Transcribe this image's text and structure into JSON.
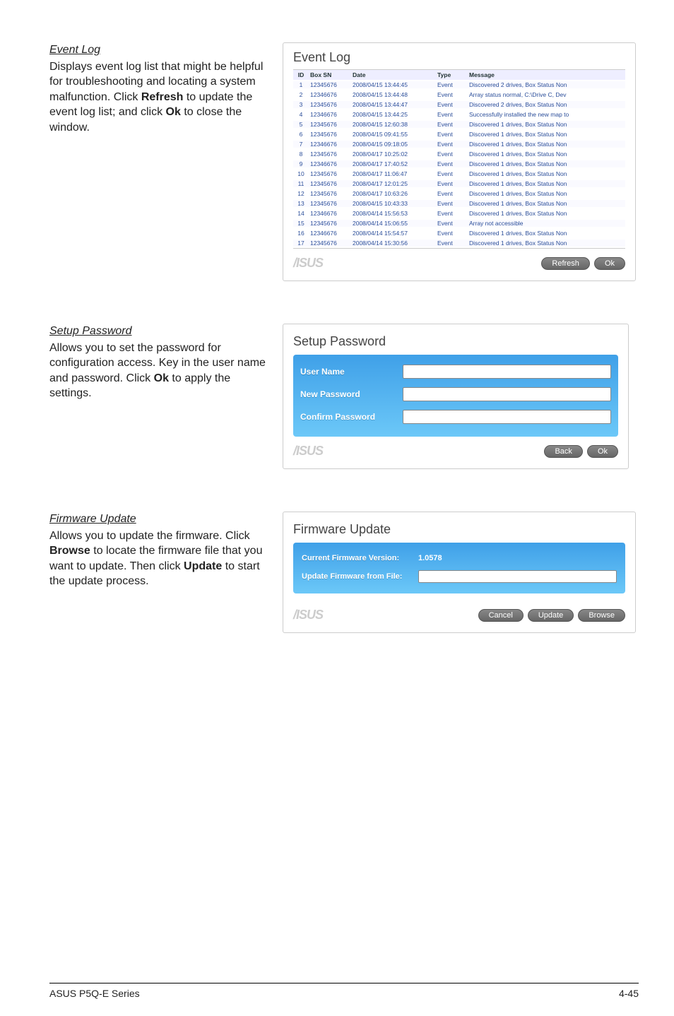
{
  "event_log": {
    "heading": "Event Log",
    "body_1": "Displays event log list that might be helpful for troubleshooting and locating a system malfunction. Click ",
    "body_bold_1": "Refresh",
    "body_2": " to update the event log list; and click ",
    "body_bold_2": "Ok",
    "body_3": " to close the window.",
    "panel_title": "Event Log",
    "cols": {
      "id": "ID",
      "sn": "Box SN",
      "date": "Date",
      "type": "Type",
      "msg": "Message"
    },
    "rows": [
      {
        "id": "1",
        "sn": "12345676",
        "date": "2008/04/15 13:44:45",
        "type": "Event",
        "msg": "Discovered 2 drives, Box Status Non"
      },
      {
        "id": "2",
        "sn": "12346676",
        "date": "2008/04/15 13:44:48",
        "type": "Event",
        "msg": "Array status normal, C:\\Drive C, Dev"
      },
      {
        "id": "3",
        "sn": "12345676",
        "date": "2008/04/15 13:44:47",
        "type": "Event",
        "msg": "Discovered 2 drives, Box Status Non"
      },
      {
        "id": "4",
        "sn": "12346676",
        "date": "2008/04/15 13:44:25",
        "type": "Event",
        "msg": "Successfully installed the new map to"
      },
      {
        "id": "5",
        "sn": "12345676",
        "date": "2008/04/15 12:60:38",
        "type": "Event",
        "msg": "Discovered 1 drives, Box Status Non"
      },
      {
        "id": "6",
        "sn": "12345676",
        "date": "2008/04/15 09:41:55",
        "type": "Event",
        "msg": "Discovered 1 drives, Box Status Non"
      },
      {
        "id": "7",
        "sn": "12346676",
        "date": "2008/04/15 09:18:05",
        "type": "Event",
        "msg": "Discovered 1 drives, Box Status Non"
      },
      {
        "id": "8",
        "sn": "12345676",
        "date": "2008/04/17 10:25:02",
        "type": "Event",
        "msg": "Discovered 1 drives, Box Status Non"
      },
      {
        "id": "9",
        "sn": "12346676",
        "date": "2008/04/17 17:40:52",
        "type": "Event",
        "msg": "Discovered 1 drives, Box Status Non"
      },
      {
        "id": "10",
        "sn": "12345676",
        "date": "2008/04/17 11:06:47",
        "type": "Event",
        "msg": "Discovered 1 drives, Box Status Non"
      },
      {
        "id": "11",
        "sn": "12345676",
        "date": "2008/04/17 12:01:25",
        "type": "Event",
        "msg": "Discovered 1 drives, Box Status Non"
      },
      {
        "id": "12",
        "sn": "12345676",
        "date": "2008/04/17 10:63:26",
        "type": "Event",
        "msg": "Discovered 1 drives, Box Status Non"
      },
      {
        "id": "13",
        "sn": "12345676",
        "date": "2008/04/15 10:43:33",
        "type": "Event",
        "msg": "Discovered 1 drives, Box Status Non"
      },
      {
        "id": "14",
        "sn": "12346676",
        "date": "2008/04/14 15:56:53",
        "type": "Event",
        "msg": "Discovered 1 drives, Box Status Non"
      },
      {
        "id": "15",
        "sn": "12345676",
        "date": "2008/04/14 15:06:55",
        "type": "Event",
        "msg": "Array not accessible"
      },
      {
        "id": "16",
        "sn": "12346676",
        "date": "2008/04/14 15:54:57",
        "type": "Event",
        "msg": "Discovered 1 drives, Box Status Non"
      },
      {
        "id": "17",
        "sn": "12345676",
        "date": "2008/04/14 15:30:56",
        "type": "Event",
        "msg": "Discovered 1 drives, Box Status Non"
      }
    ],
    "brand": "ISUS",
    "buttons": {
      "refresh": "Refresh",
      "ok": "Ok"
    }
  },
  "setup_pw": {
    "heading": "Setup Password",
    "body_1": "Allows you to set the password for configuration access. Key in the user name and password. Click ",
    "body_bold_1": "Ok",
    "body_2": " to apply the settings.",
    "panel_title": "Setup Password",
    "labels": {
      "user": "User Name",
      "new": "New Password",
      "confirm": "Confirm Password"
    },
    "brand": "ISUS",
    "buttons": {
      "back": "Back",
      "ok": "Ok"
    }
  },
  "firmware": {
    "heading": "Firmware Update",
    "body_1": "Allows you to update the firmware. Click ",
    "body_bold_1": "Browse",
    "body_2": " to locate the firmware file that you want to update. Then click ",
    "body_bold_2": "Update",
    "body_3": " to start the update process.",
    "panel_title": "Firmware Update",
    "labels": {
      "current": "Current Firmware Version:",
      "file": "Update Firmware from File:"
    },
    "version": "1.0578",
    "brand": "ISUS",
    "buttons": {
      "cancel": "Cancel",
      "update": "Update",
      "browse": "Browse"
    }
  },
  "footer": {
    "left": "ASUS P5Q-E Series",
    "right": "4-45"
  }
}
